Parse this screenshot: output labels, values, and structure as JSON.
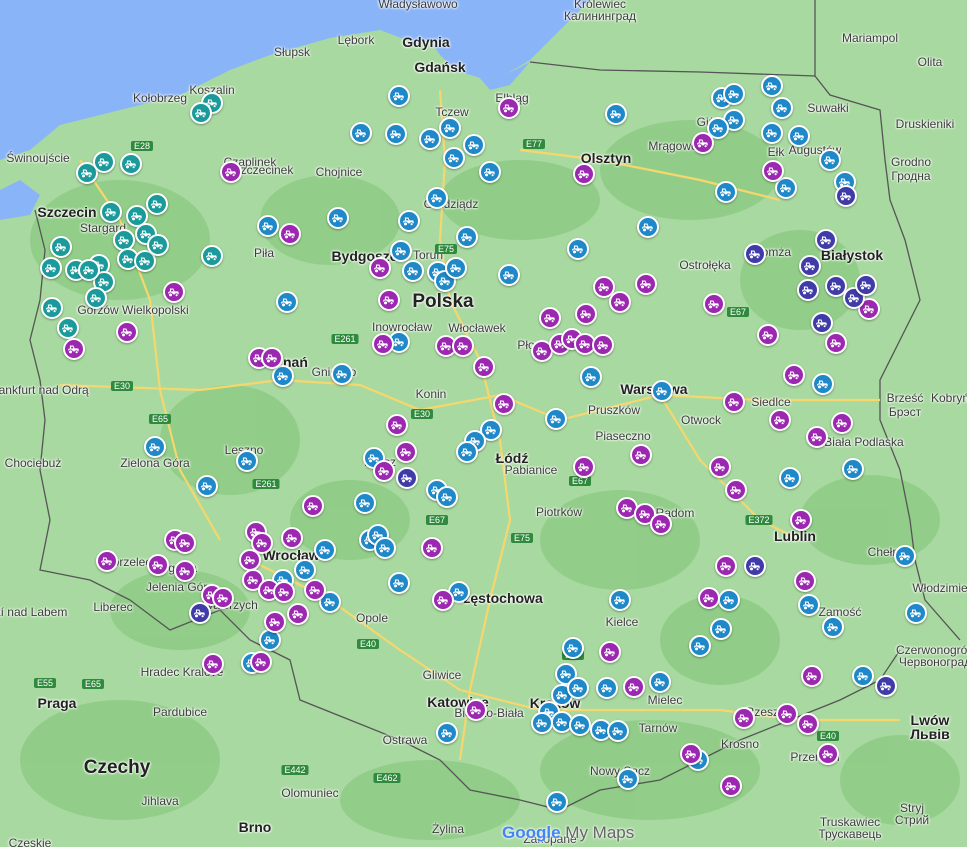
{
  "map": {
    "colors": {
      "sea": "#8ab4f8",
      "land": "#a8d9a0",
      "forest": "#8fcc86",
      "border": "#555555",
      "pin_blue": "#1e88c8",
      "pin_purple": "#9c27b0",
      "pin_teal": "#1a9a9a",
      "pin_navy": "#3f3ba8",
      "road": "#f5d76e"
    },
    "country_labels": [
      {
        "text": "Polska",
        "size": "xl"
      },
      {
        "text": "Czechy",
        "size": "xl"
      }
    ],
    "city_labels": [
      "Władysławowo",
      "Gdynia",
      "Gdańsk",
      "Królewiec",
      "Калининград",
      "Lębork",
      "Słupsk",
      "Kołobrzeg",
      "Koszalin",
      "Świnoujście",
      "Szczecin",
      "Stargard",
      "Gorzów Wielkopolski",
      "Piła",
      "Czaplinek",
      "Szczecinek",
      "Chojnice",
      "Tczew",
      "Elbląg",
      "Olsztyn",
      "Mrągowo",
      "Giżycko",
      "Ełk",
      "Suwałki",
      "Augustów",
      "Mariampol",
      "Olita",
      "Druskieniki",
      "Grodno",
      "Гродна",
      "Białystok",
      "Łomża",
      "Ostrołęka",
      "Bydgoszcz",
      "Grudziądz",
      "Toruń",
      "Inowrocław",
      "Włocławek",
      "Płock",
      "Gniezno",
      "Poznań",
      "Konin",
      "Frankfurt nad Odrą",
      "Zielona Góra",
      "Chociebuż",
      "Leszno",
      "Kalisz",
      "Łódź",
      "Pabianice",
      "Piotrków",
      "Warszawa",
      "Pruszków",
      "Piaseczno",
      "Otwock",
      "Siedlce",
      "Biała Podlaska",
      "Brześć",
      "Брэст",
      "Kobryń",
      "Radom",
      "Lublin",
      "Chełm",
      "Włodzimierz",
      "Zamość",
      "Czerwonogród",
      "Червоноград",
      "Kielce",
      "Mielec",
      "Rzeszów",
      "Tarnów",
      "Przemyśl",
      "Krosno",
      "Nowy Sącz",
      "Lwów",
      "Львів",
      "Truskawiec",
      "Трускавець",
      "Stryj",
      "Стрий",
      "Kraków",
      "Katowice",
      "Gliwice",
      "Bielsko-Biała",
      "Ostrawa",
      "Opole",
      "Częstochowa",
      "Wrocław",
      "Legnica",
      "Jelenia Góra",
      "Wałbrzych",
      "Zgorzelec",
      "Liberec",
      "Ústí nad Labem",
      "Hradec Kralove",
      "Pardubice",
      "Praga",
      "Olomuniec",
      "Jihlava",
      "Brno",
      "Żylina",
      "Zakopane",
      "Czeskie"
    ],
    "road_shields": [
      "E28",
      "E77",
      "E75",
      "E261",
      "E30",
      "E65",
      "E67",
      "E261",
      "E67",
      "E75",
      "E372",
      "E40",
      "E77",
      "E462",
      "E442",
      "E55",
      "E65",
      "E40",
      "E67",
      "E30"
    ],
    "attribution": {
      "google": "Google",
      "product": "My Maps"
    }
  }
}
